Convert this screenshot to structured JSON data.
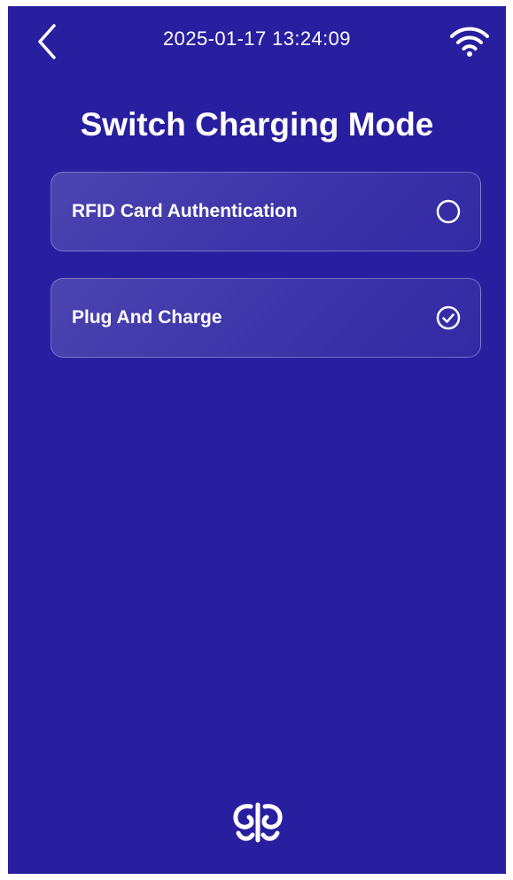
{
  "status_bar": {
    "datetime": "2025-01-17 13:24:09",
    "back_icon": "chevron-left-icon",
    "wifi_icon": "wifi-icon"
  },
  "page": {
    "title": "Switch Charging Mode"
  },
  "options": [
    {
      "label": "RFID Card Authentication",
      "selected": false,
      "icon": "radio-empty-icon"
    },
    {
      "label": "Plug And Charge",
      "selected": true,
      "icon": "check-circle-icon"
    }
  ],
  "footer": {
    "logo_icon": "brand-logo-icon"
  },
  "colors": {
    "background": "#281fa0",
    "text": "#ffffff"
  }
}
